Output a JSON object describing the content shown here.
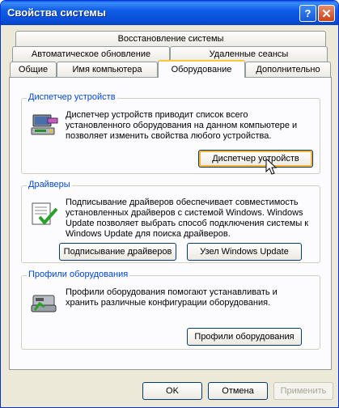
{
  "window": {
    "title": "Свойства системы",
    "help_label": "?",
    "close_label": "✕"
  },
  "tabs": {
    "row1": [
      {
        "label": "Восстановление системы"
      }
    ],
    "row2": [
      {
        "label": "Автоматическое обновление"
      },
      {
        "label": "Удаленные сеансы"
      }
    ],
    "row3": [
      {
        "label": "Общие"
      },
      {
        "label": "Имя компьютера"
      },
      {
        "label": "Оборудование",
        "active": true
      },
      {
        "label": "Дополнительно"
      }
    ]
  },
  "device_manager": {
    "title": "Диспетчер устройств",
    "description": "Диспетчер устройств приводит список всего установленного оборудования на данном компьютере и позволяет изменить свойства любого устройства.",
    "button": "Диспетчер устройств",
    "icon": "device-manager-icon"
  },
  "drivers": {
    "title": "Драйверы",
    "description": "Подписывание драйверов обеспечивает совместимость установленных драйверов с системой Windows.  Windows Update позволяет выбрать способ подключения системы к Windows Update для поиска драйверов.",
    "signing_button": "Подписывание драйверов",
    "update_button": "Узел Windows Update",
    "icon": "driver-signing-icon"
  },
  "profiles": {
    "title": "Профили оборудования",
    "description": "Профили оборудования помогают устанавливать и хранить различные конфигурации оборудования.",
    "button": "Профили оборудования",
    "icon": "hardware-profiles-icon"
  },
  "footer": {
    "ok": "OK",
    "cancel": "Отмена",
    "apply": "Применить"
  },
  "colors": {
    "accent": "#0046d5",
    "titlebar": "#0a4fd8",
    "hot_border": "#f8b33c"
  }
}
